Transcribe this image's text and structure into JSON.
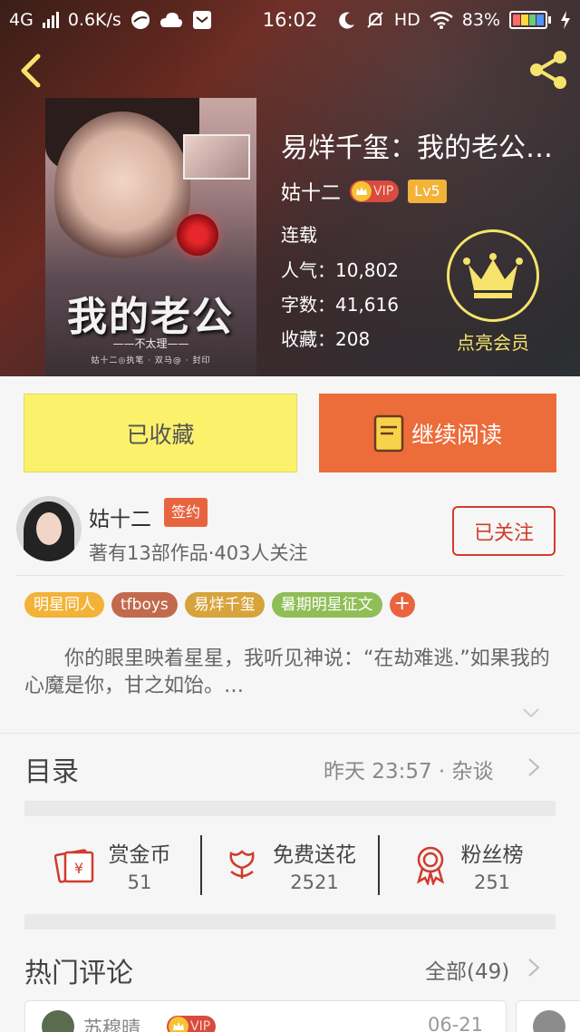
{
  "status_bar": {
    "network": "4G",
    "speed": "0.6K/s",
    "time": "16:02",
    "hd": "HD",
    "battery_pct": "83%",
    "icons": [
      "signal-icon",
      "browser-icon",
      "weather-icon",
      "mail-icon",
      "moon-icon",
      "mute-icon",
      "wifi-icon",
      "battery-icon",
      "charging-icon"
    ]
  },
  "header": {
    "back_icon": "chevron-left-icon",
    "share_icon": "share-icon",
    "icon_color": "#f5e36b"
  },
  "cover": {
    "title": "我的老公",
    "subtitle": "——不太理——",
    "footer": "姑十二◎执笔 · 双马@ · 封印"
  },
  "book": {
    "title": "易烊千玺：我的老公…",
    "author": "姑十二",
    "vip_label": "VIP",
    "level": "Lv5",
    "status": "连载",
    "popularity_label": "人气：",
    "popularity": "10,802",
    "words_label": "字数：",
    "words": "41,616",
    "favorites_label": "收藏：",
    "favorites": "208"
  },
  "member": {
    "label": "点亮会员",
    "icon": "crown-icon"
  },
  "actions": {
    "collect_label": "已收藏",
    "read_label": "继续阅读",
    "read_icon": "book-icon"
  },
  "author": {
    "name": "姑十二",
    "badge": "签约",
    "meta": "著有13部作品·403人关注",
    "follow_label": "已关注"
  },
  "tags": [
    {
      "label": "明星同人",
      "color": "#f2b338"
    },
    {
      "label": "tfboys",
      "color": "#c26a4e"
    },
    {
      "label": "易烊千玺",
      "color": "#d7a33b"
    },
    {
      "label": "暑期明星征文",
      "color": "#8fbe56"
    }
  ],
  "tag_add": "+",
  "synopsis": "你的眼里映着星星，我听见神说：“在劫难逃.”如果我的心魔是你，甘之如饴。…",
  "toc": {
    "title": "目录",
    "update": "昨天 23:57 · 杂谈"
  },
  "stats": [
    {
      "label": "赏金币",
      "value": "51",
      "icon": "red-envelope-icon"
    },
    {
      "label": "免费送花",
      "value": "2521",
      "icon": "flower-icon"
    },
    {
      "label": "粉丝榜",
      "value": "251",
      "icon": "medal-icon"
    }
  ],
  "comments": {
    "title": "热门评论",
    "all_label": "全部(49)",
    "first": {
      "name": "苏穆晴",
      "vip": "VIP",
      "date": "06-21"
    }
  },
  "colors": {
    "accent_orange": "#ec6c3a",
    "collect_yellow": "#fcf16b",
    "follow_red": "#d23b2d"
  }
}
